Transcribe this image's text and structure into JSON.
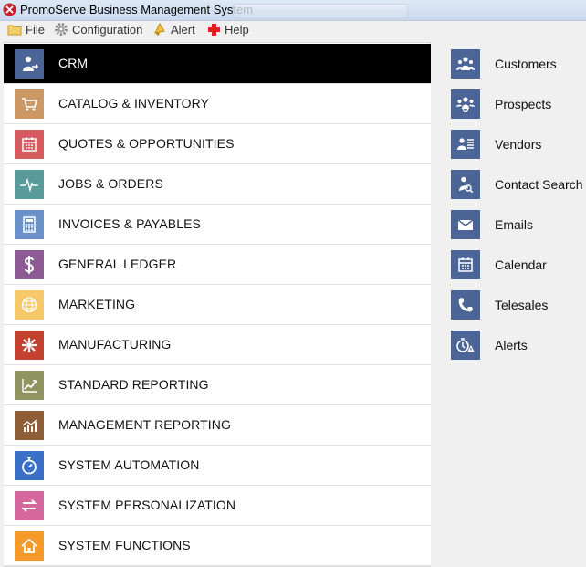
{
  "window": {
    "title": "PromoServe Business Management System"
  },
  "menu": [
    {
      "label": "File",
      "icon": "folder-icon"
    },
    {
      "label": "Configuration",
      "icon": "gear-icon"
    },
    {
      "label": "Alert",
      "icon": "bell-icon"
    },
    {
      "label": "Help",
      "icon": "help-icon"
    }
  ],
  "nav": [
    {
      "label": "CRM",
      "icon": "crm-person-icon",
      "color": "#4a6596",
      "active": true
    },
    {
      "label": "CATALOG & INVENTORY",
      "icon": "cart-icon",
      "color": "#cc9966"
    },
    {
      "label": "QUOTES & OPPORTUNITIES",
      "icon": "calendar-grid-icon",
      "color": "#d55b5f"
    },
    {
      "label": "JOBS & ORDERS",
      "icon": "pulse-icon",
      "color": "#5b9a9a"
    },
    {
      "label": "INVOICES & PAYABLES",
      "icon": "calculator-icon",
      "color": "#6a92c9"
    },
    {
      "label": "GENERAL LEDGER",
      "icon": "dollar-icon",
      "color": "#8d5a93"
    },
    {
      "label": "MARKETING",
      "icon": "globe-icon",
      "color": "#f5c86a"
    },
    {
      "label": "MANUFACTURING",
      "icon": "gears-icon",
      "color": "#c2412f"
    },
    {
      "label": "STANDARD REPORTING",
      "icon": "trend-chart-icon",
      "color": "#8f9460"
    },
    {
      "label": "MANAGEMENT REPORTING",
      "icon": "bar-chart-icon",
      "color": "#8d5e37"
    },
    {
      "label": "SYSTEM AUTOMATION",
      "icon": "stopwatch-icon",
      "color": "#3c6fc7"
    },
    {
      "label": "SYSTEM PERSONALIZATION",
      "icon": "swap-arrows-icon",
      "color": "#d4679b"
    },
    {
      "label": "SYSTEM FUNCTIONS",
      "icon": "home-icon",
      "color": "#f39a2b"
    }
  ],
  "crm_menu": [
    {
      "label": "Customers",
      "icon": "customers-icon"
    },
    {
      "label": "Prospects",
      "icon": "prospects-icon"
    },
    {
      "label": "Vendors",
      "icon": "vendors-icon"
    },
    {
      "label": "Contact Search",
      "icon": "contact-search-icon"
    },
    {
      "label": "Emails",
      "icon": "envelope-icon"
    },
    {
      "label": "Calendar",
      "icon": "calendar-icon"
    },
    {
      "label": "Telesales",
      "icon": "phone-icon"
    },
    {
      "label": "Alerts",
      "icon": "alerts-icon"
    }
  ]
}
